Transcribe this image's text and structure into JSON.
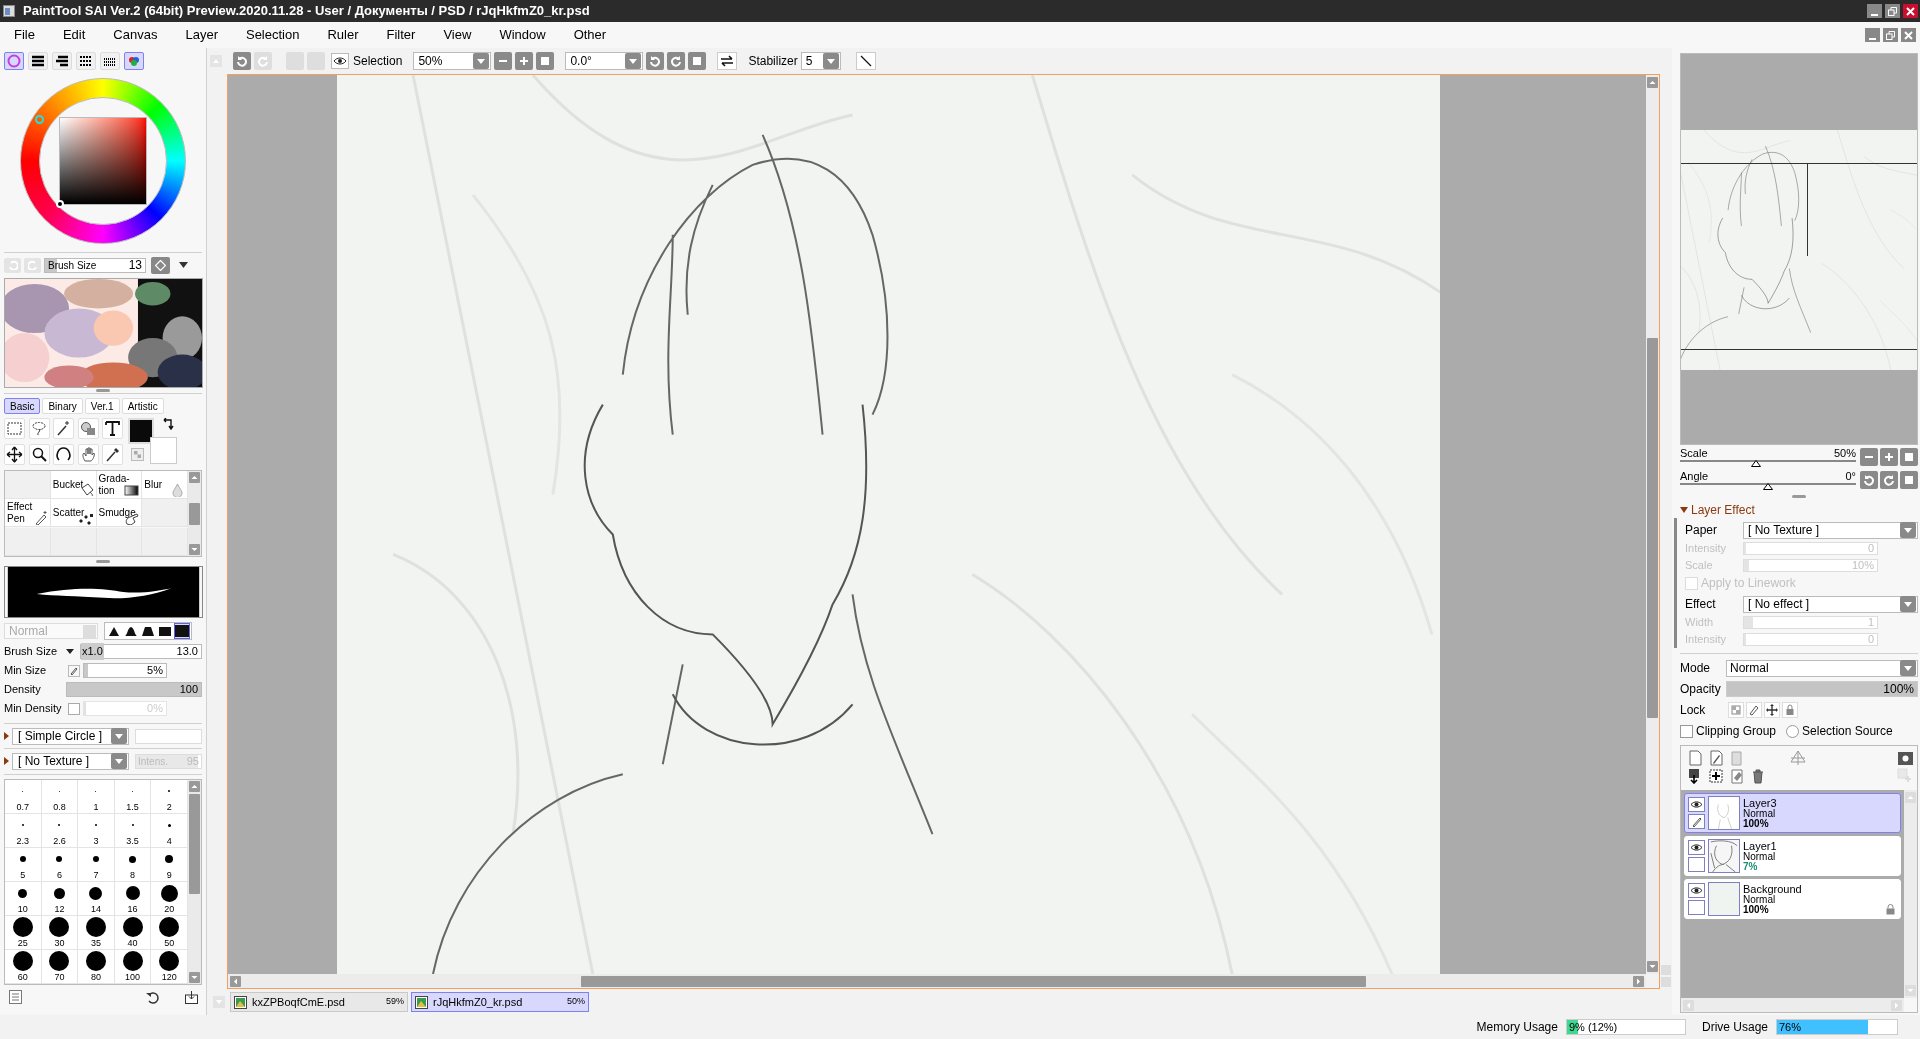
{
  "window": {
    "title": "PaintTool SAI Ver.2 (64bit) Preview.2020.11.28 - User / Документы / PSD / rJqHkfmZ0_kr.psd"
  },
  "menu": [
    "File",
    "Edit",
    "Canvas",
    "Layer",
    "Selection",
    "Ruler",
    "Filter",
    "View",
    "Window",
    "Other"
  ],
  "color_modes": [
    {
      "kind": "wheel",
      "selected": true
    },
    {
      "kind": "rgb",
      "selected": false
    },
    {
      "kind": "hsv",
      "selected": false
    },
    {
      "kind": "swatches",
      "selected": false
    },
    {
      "kind": "grid",
      "selected": false
    },
    {
      "kind": "mixer",
      "selected": true
    }
  ],
  "brush_size_field": {
    "label": "Brush Size",
    "value": "13"
  },
  "tool_tabs": [
    {
      "label": "Basic",
      "selected": true
    },
    {
      "label": "Binary",
      "selected": false
    },
    {
      "label": "Ver.1",
      "selected": false
    },
    {
      "label": "Artistic",
      "selected": false
    }
  ],
  "brush_slots": [
    {
      "kind": "empty"
    },
    {
      "kind": "bucket",
      "label": "Bucket"
    },
    {
      "kind": "gradation",
      "label": "Grada-\ntion"
    },
    {
      "kind": "blur",
      "label": "Blur"
    },
    {
      "kind": "effect",
      "label": "Effect\nPen"
    },
    {
      "kind": "scatter",
      "label": "Scatter"
    },
    {
      "kind": "smudge",
      "label": "Smudge"
    },
    {
      "kind": "empty"
    },
    {
      "kind": "empty"
    },
    {
      "kind": "empty"
    },
    {
      "kind": "empty"
    },
    {
      "kind": "empty"
    }
  ],
  "brush": {
    "blend_mode": "Normal",
    "shapes": [
      {
        "selected": false
      },
      {
        "selected": false
      },
      {
        "selected": false
      },
      {
        "selected": false
      },
      {
        "selected": true
      }
    ],
    "settings": [
      {
        "kind": "size",
        "label": "Brush Size",
        "multiplier": "x1.0",
        "value": "13.0"
      },
      {
        "kind": "slider",
        "label": "Min Size",
        "value": "5%",
        "level": 0.05
      },
      {
        "kind": "slider",
        "label": "Density",
        "value": "100",
        "level": 1
      },
      {
        "kind": "check",
        "label": "Min Density",
        "value": "0%",
        "checked": false,
        "level": 0
      }
    ],
    "shape": "[ Simple Circle ]",
    "texture": "[ No Texture ]",
    "texture_intensity": {
      "label": "Intens.",
      "value": "95",
      "level": 0.95
    }
  },
  "brush_sizes": [
    "0.7",
    "0.8",
    "1",
    "1.5",
    "2",
    "2.3",
    "2.6",
    "3",
    "3.5",
    "4",
    "5",
    "6",
    "7",
    "8",
    "9",
    "10",
    "12",
    "14",
    "16",
    "20",
    "25",
    "30",
    "35",
    "40",
    "50",
    "60",
    "70",
    "80",
    "100",
    "120"
  ],
  "toolbar": {
    "view_label": "Selection",
    "zoom": "50%",
    "angle": "0.0°",
    "stabilizer_label": "Stabilizer",
    "stabilizer": "5"
  },
  "documents": [
    {
      "name": "kxZPBoqfCmE.psd",
      "zoom": "59%",
      "selected": false
    },
    {
      "name": "rJqHkfmZ0_kr.psd",
      "zoom": "50%",
      "selected": true
    }
  ],
  "navigator": {
    "controls": [
      {
        "label": "Scale",
        "value": "50%",
        "level": 0.43
      },
      {
        "label": "Angle",
        "value": "0°",
        "level": 0.5
      }
    ]
  },
  "layer_effect": {
    "title": "Layer Effect",
    "expanded": true,
    "rows": [
      {
        "kind": "dropdown",
        "label": "Paper",
        "value": "[ No Texture ]",
        "disabled": false
      },
      {
        "kind": "slider",
        "label": "Intensity",
        "value": "0",
        "level": 0,
        "disabled": true
      },
      {
        "kind": "slider",
        "label": "Scale",
        "value": "10%",
        "level": 0.02,
        "disabled": true
      },
      {
        "kind": "check",
        "label": "Apply to Linework",
        "checked": false,
        "disabled": true
      },
      {
        "kind": "dropdown",
        "label": "Effect",
        "value": "[ No effect ]",
        "disabled": false
      },
      {
        "kind": "slider",
        "label": "Width",
        "value": "1",
        "level": 0.05,
        "disabled": true
      },
      {
        "kind": "slider",
        "label": "Intensity",
        "value": "0",
        "level": 0,
        "disabled": true
      }
    ]
  },
  "layer_properties": {
    "mode_label": "Mode",
    "mode": "Normal",
    "opacity_label": "Opacity",
    "opacity": "100%",
    "level": 1,
    "lock_label": "Lock",
    "options": [
      {
        "kind": "check",
        "label": "Clipping Group",
        "checked": false
      },
      {
        "kind": "radio",
        "label": "Selection Source",
        "checked": false
      }
    ]
  },
  "layers": [
    {
      "name": "Layer3",
      "mode": "Normal",
      "opacity": "100%",
      "color": "#000000",
      "selected": true,
      "visible": true,
      "editing": true,
      "locked": false
    },
    {
      "name": "Layer1",
      "mode": "Normal",
      "opacity": "7%",
      "color": "#1a9070",
      "selected": false,
      "visible": true,
      "editing": false,
      "locked": false
    },
    {
      "name": "Background",
      "mode": "Normal",
      "opacity": "100%",
      "color": "#000000",
      "selected": false,
      "visible": true,
      "editing": false,
      "locked": true
    }
  ],
  "status": {
    "memory": {
      "label": "Memory Usage",
      "value": "9% (12%)",
      "level": 0.09
    },
    "drive": {
      "label": "Drive Usage",
      "value": "76%",
      "level": 0.76
    }
  }
}
